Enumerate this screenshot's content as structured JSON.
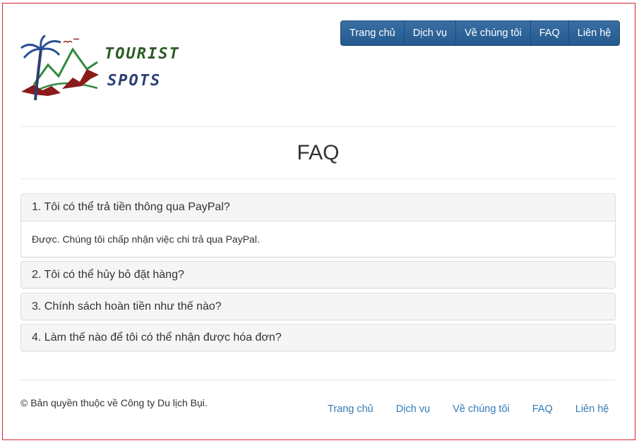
{
  "brand": {
    "logo_line1": "TOURIST",
    "logo_line2": "SPOTS"
  },
  "nav": {
    "items": [
      "Trang chủ",
      "Dịch vụ",
      "Về chúng tôi",
      "FAQ",
      "Liên hệ"
    ]
  },
  "page": {
    "title": "FAQ"
  },
  "faq": [
    {
      "question": "1. Tôi có thể trả tiền thông qua PayPal?",
      "answer": "Được. Chúng tôi chấp nhận việc chi trả qua PayPal.",
      "expanded": true
    },
    {
      "question": "2. Tôi có thể hủy bỏ đặt hàng?",
      "expanded": false
    },
    {
      "question": "3. Chính sách hoàn tiền như thế nào?",
      "expanded": false
    },
    {
      "question": "4. Làm thế nào để tôi có thể nhận được hóa đơn?",
      "expanded": false
    }
  ],
  "footer": {
    "copyright": "© Bản quyền thuộc về Công ty Du lịch Bụi.",
    "links": [
      "Trang chủ",
      "Dịch vụ",
      "Về chúng tôi",
      "FAQ",
      "Liên hệ"
    ]
  },
  "colors": {
    "nav_bg": "#2b5f93",
    "link": "#337ab7",
    "frame_border": "#d9242a"
  }
}
